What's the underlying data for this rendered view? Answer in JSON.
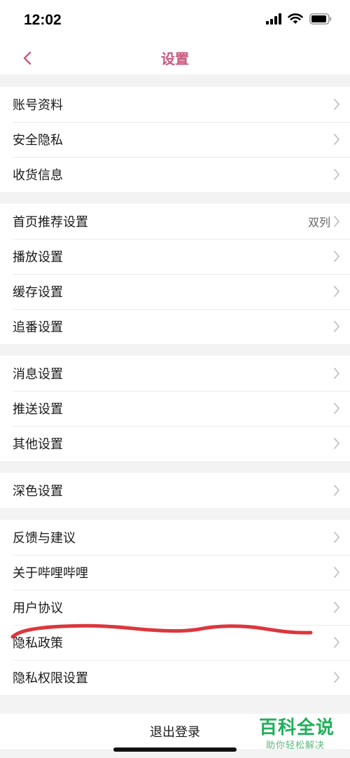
{
  "status_bar": {
    "time": "12:02"
  },
  "nav": {
    "title": "设置"
  },
  "groups": [
    {
      "items": [
        {
          "label": "账号资料"
        },
        {
          "label": "安全隐私"
        },
        {
          "label": "收货信息"
        }
      ]
    },
    {
      "items": [
        {
          "label": "首页推荐设置",
          "value": "双列"
        },
        {
          "label": "播放设置"
        },
        {
          "label": "缓存设置"
        },
        {
          "label": "追番设置"
        }
      ]
    },
    {
      "items": [
        {
          "label": "消息设置"
        },
        {
          "label": "推送设置"
        },
        {
          "label": "其他设置"
        }
      ]
    },
    {
      "items": [
        {
          "label": "深色设置"
        }
      ]
    },
    {
      "items": [
        {
          "label": "反馈与建议"
        },
        {
          "label": "关于哔哩哔哩"
        },
        {
          "label": "用户协议"
        },
        {
          "label": "隐私政策"
        },
        {
          "label": "隐私权限设置"
        }
      ]
    }
  ],
  "logout": {
    "label": "退出登录"
  },
  "watermark": {
    "main": "百科全说",
    "sub": "助你轻松解决"
  },
  "colors": {
    "accent": "#c9587c",
    "annotation": "#d8262c",
    "watermark": "#1fb05a"
  }
}
